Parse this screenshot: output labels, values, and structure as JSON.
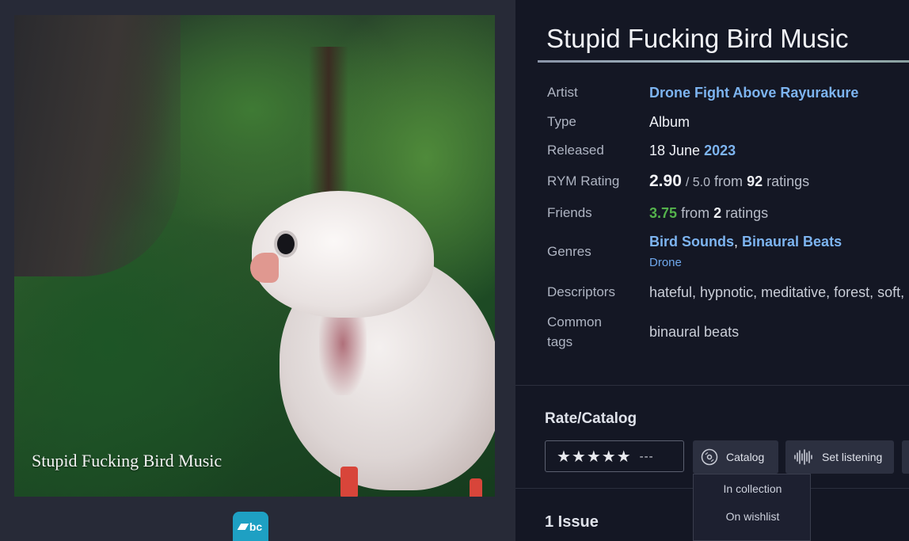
{
  "cover": {
    "caption": "Stupid Fucking Bird Music",
    "badge": "bc"
  },
  "album": {
    "title": "Stupid Fucking Bird Music"
  },
  "info": {
    "artist_label": "Artist",
    "artist": "Drone Fight Above Rayurakure",
    "type_label": "Type",
    "type": "Album",
    "released_label": "Released",
    "released_day_month": "18 June",
    "released_year": "2023",
    "rating_label": "RYM Rating",
    "rating": "2.90",
    "rating_scale": "/ 5.0",
    "rating_from": "from",
    "rating_count": "92",
    "rating_suffix": "ratings",
    "friends_label": "Friends",
    "friends_rating": "3.75",
    "friends_from": "from",
    "friends_count": "2",
    "friends_suffix": "ratings",
    "genres_label": "Genres",
    "genre_primary_1": "Bird Sounds",
    "genre_sep": ",",
    "genre_primary_2": "Binaural Beats",
    "genre_secondary": "Drone",
    "descriptors_label": "Descriptors",
    "descriptors": "hateful, hypnotic, meditative, forest, soft,",
    "tags_label_1": "Common",
    "tags_label_2": "tags",
    "tags": "binaural beats"
  },
  "rate_catalog": {
    "heading": "Rate/Catalog",
    "stars": "★★★★★",
    "rating_value": "---",
    "catalog_button": "Catalog",
    "listening_button": "Set listening",
    "dropdown_options": [
      "In collection",
      "On wishlist"
    ]
  },
  "issues": {
    "heading": "1 Issue"
  }
}
